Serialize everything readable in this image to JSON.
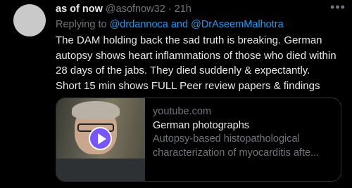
{
  "tweet": {
    "display_name": "as of now",
    "handle": "@asofnow32",
    "separator": "·",
    "time": "21h",
    "more_icon": "more-horizontal-icon",
    "replying_prefix": "Replying to",
    "mention_1": "@drdannoca",
    "replying_and": "and",
    "mention_2": "@DrAseemMalhotra",
    "body_lines": [
      "The DAM holding back the sad truth is  breaking.  German",
      "autopsy shows heart inflammations of those who died within",
      "28 days of the jabs. They died suddenly & expectantly.",
      "Short 15 min shows FULL Peer review papers & findings"
    ]
  },
  "card": {
    "domain": "youtube.com",
    "title": "German photographs",
    "desc_line_1": "Autopsy-based histopathological",
    "desc_line_2": "characterization of myocarditis afte...",
    "play_icon": "play-icon",
    "accent_color": "#7856ff"
  }
}
